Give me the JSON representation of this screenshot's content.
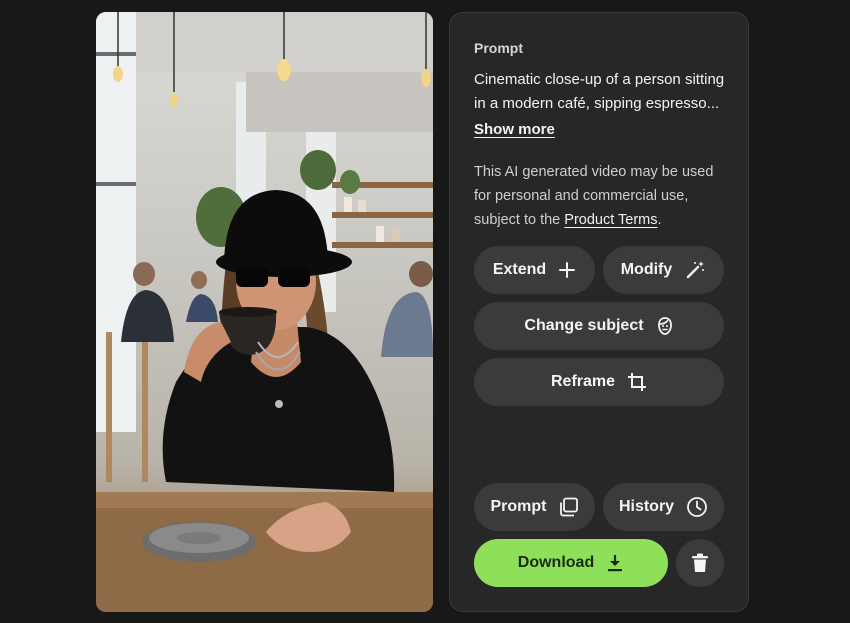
{
  "prompt_panel": {
    "label": "Prompt",
    "text": "Cinematic close-up of a person sitting in a modern café, sipping espresso...",
    "show_more": "Show more",
    "usage_prefix": "This AI generated video may be used for personal and commercial use, subject to the ",
    "terms_link": "Product Terms",
    "usage_suffix": "."
  },
  "actions": {
    "extend": "Extend",
    "modify": "Modify",
    "change_subject": "Change subject",
    "reframe": "Reframe",
    "prompt": "Prompt",
    "history": "History",
    "download": "Download"
  },
  "colors": {
    "background": "#181818",
    "panel": "#272727",
    "button": "#3b3b3b",
    "download_accent": "#8ee05a"
  },
  "icons": [
    "plus-icon",
    "magic-wand-icon",
    "face-icon",
    "crop-icon",
    "copy-icon",
    "clock-icon",
    "download-icon",
    "trash-icon"
  ]
}
